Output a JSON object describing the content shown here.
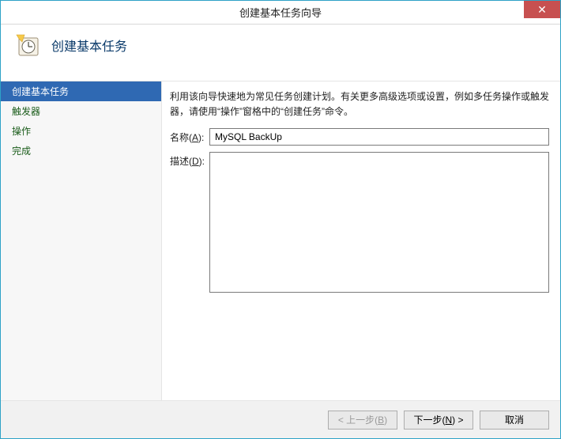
{
  "window": {
    "title": "创建基本任务向导",
    "close_glyph": "✕"
  },
  "header": {
    "title": "创建基本任务"
  },
  "sidebar": {
    "items": [
      {
        "label": "创建基本任务",
        "active": true
      },
      {
        "label": "触发器",
        "active": false
      },
      {
        "label": "操作",
        "active": false
      },
      {
        "label": "完成",
        "active": false
      }
    ]
  },
  "main": {
    "intro": "利用该向导快速地为常见任务创建计划。有关更多高级选项或设置，例如多任务操作或触发器，请使用“操作”窗格中的“创建任务”命令。",
    "name_label_pre": "名称(",
    "name_label_key": "A",
    "name_label_post": "):",
    "name_value": "MySQL BackUp",
    "desc_label_pre": "描述(",
    "desc_label_key": "D",
    "desc_label_post": "):",
    "desc_value": ""
  },
  "footer": {
    "back_pre": "< 上一步(",
    "back_key": "B",
    "back_post": ")",
    "next_pre": "下一步(",
    "next_key": "N",
    "next_post": ") >",
    "cancel": "取消"
  }
}
